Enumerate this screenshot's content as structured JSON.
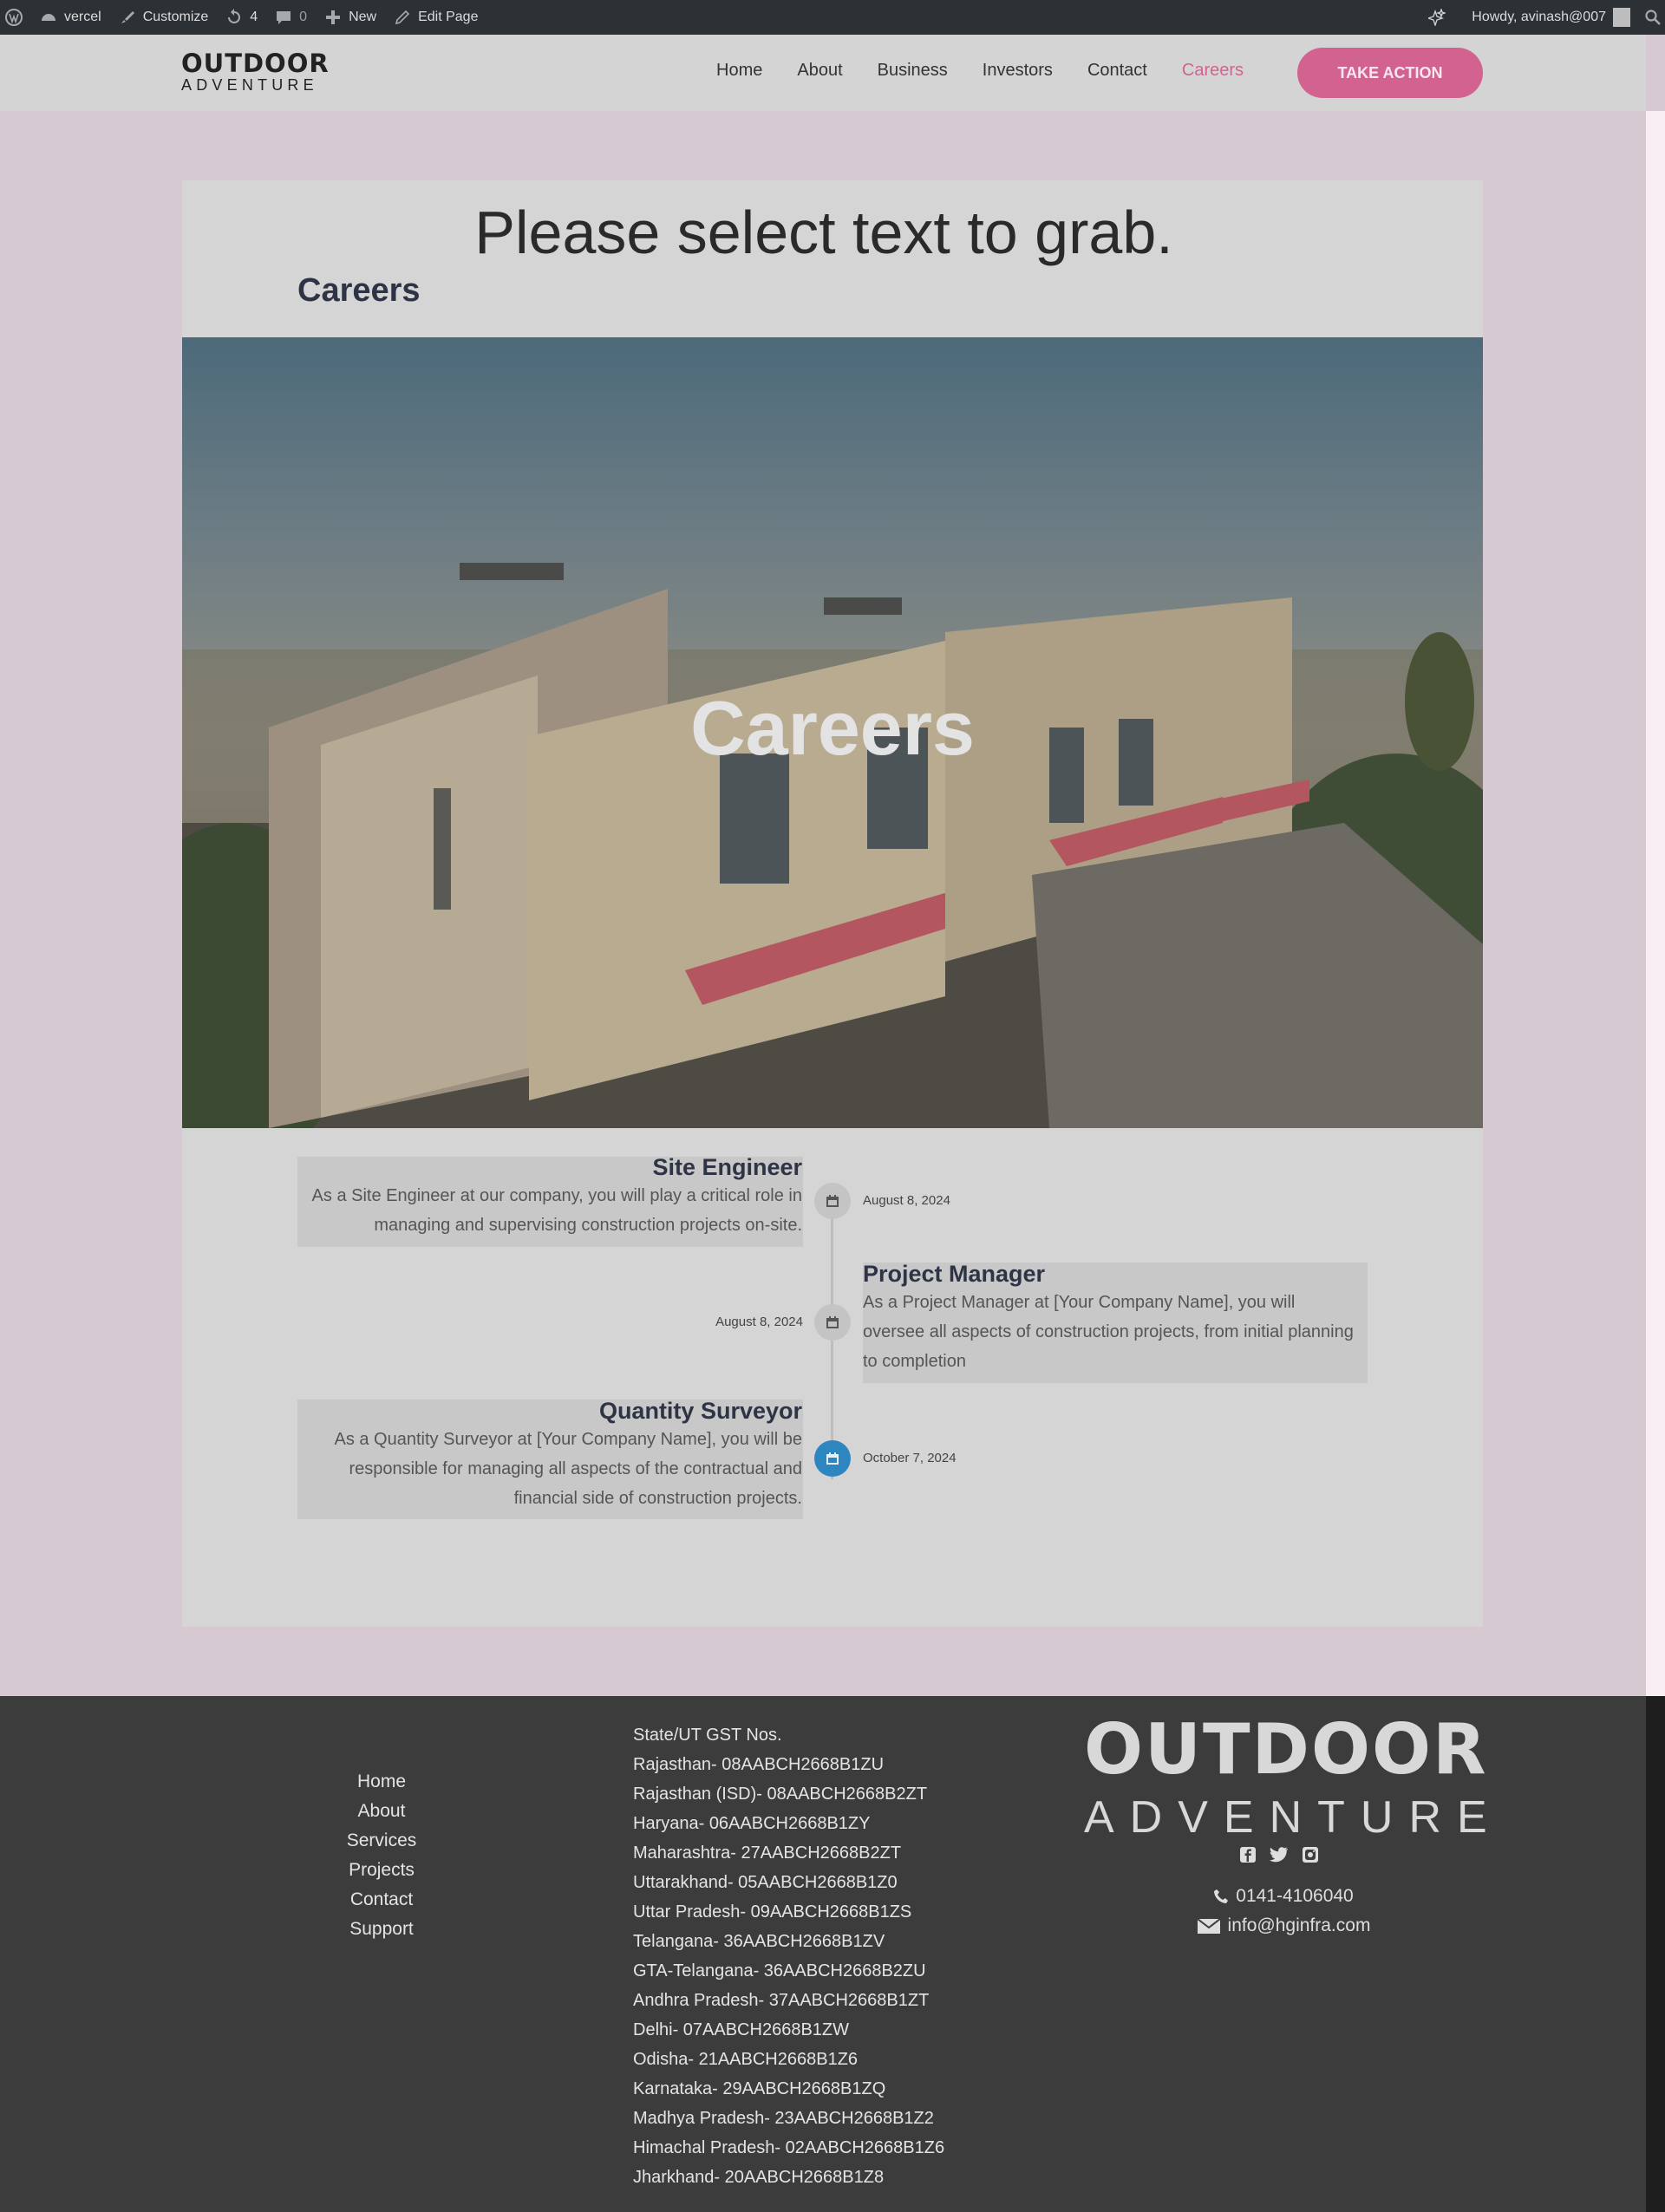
{
  "admin_bar": {
    "site_name": "vercel",
    "customize": "Customize",
    "updates_count": "4",
    "comments_count": "0",
    "new_label": "New",
    "edit_page": "Edit Page",
    "howdy": "Howdy, avinash@007"
  },
  "header": {
    "logo_top": "OUTDOOR",
    "logo_bottom": "ADVENTURE",
    "nav": [
      "Home",
      "About",
      "Business",
      "Investors",
      "Contact",
      "Careers"
    ],
    "active_nav": "Careers",
    "cta_label": "TAKE ACTION",
    "accent_color": "#d26391"
  },
  "main": {
    "grab_text": "Please select text to grab.",
    "page_title": "Careers",
    "hero_title": "Careers"
  },
  "timeline": [
    {
      "title": "Site Engineer",
      "description": "As a Site Engineer at our company, you will play a critical role in managing and supervising construction projects on-site.",
      "date": "August 8, 2024",
      "icon": "calendar-icon"
    },
    {
      "title": "Project Manager",
      "description": "As a Project Manager at [Your Company Name], you will oversee all aspects of construction projects, from initial planning to completion",
      "date": "August 8, 2024",
      "icon": "calendar-icon"
    },
    {
      "title": "Quantity Surveyor",
      "description": "As a Quantity Surveyor at [Your Company Name], you will be responsible for managing all aspects of the contractual and financial side of construction projects.",
      "date": "October 7, 2024",
      "icon": "calendar-icon"
    }
  ],
  "footer": {
    "links": [
      "Home",
      "About",
      "Services",
      "Projects",
      "Contact",
      "Support"
    ],
    "gst_heading": "State/UT GST Nos.",
    "gst": [
      "Rajasthan- 08AABCH2668B1ZU",
      "Rajasthan (ISD)- 08AABCH2668B2ZT",
      "Haryana- 06AABCH2668B1ZY",
      "Maharashtra- 27AABCH2668B2ZT",
      "Uttarakhand- 05AABCH2668B1Z0",
      "Uttar Pradesh- 09AABCH2668B1ZS",
      "Telangana- 36AABCH2668B1ZV",
      "GTA-Telangana- 36AABCH2668B2ZU",
      "Andhra Pradesh- 37AABCH2668B1ZT",
      "Delhi- 07AABCH2668B1ZW",
      "Odisha- 21AABCH2668B1Z6",
      "Karnataka- 29AABCH2668B1ZQ",
      "Madhya Pradesh- 23AABCH2668B1Z2",
      "Himachal Pradesh- 02AABCH2668B1Z6",
      "Jharkhand- 20AABCH2668B1Z8"
    ],
    "logo_top": "OUTDOOR",
    "logo_bottom": "ADVENTURE",
    "social": [
      "facebook-icon",
      "twitter-icon",
      "instagram-icon"
    ],
    "phone": "0141-4106040",
    "email": "info@hginfra.com"
  }
}
